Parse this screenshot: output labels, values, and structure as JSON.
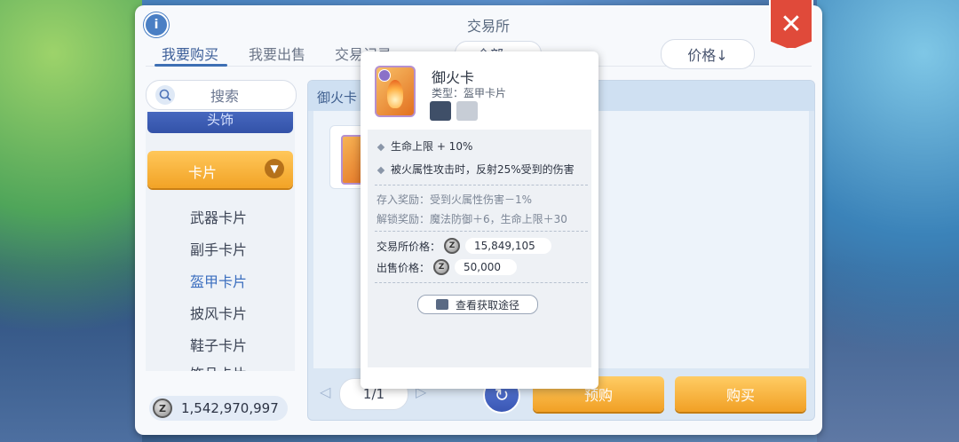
{
  "window": {
    "title": "交易所"
  },
  "tabs": [
    {
      "label": "我要购买",
      "active": true
    },
    {
      "label": "我要出售",
      "active": false
    },
    {
      "label": "交易记录",
      "active": false
    }
  ],
  "filter": {
    "dropdown_value": "全部"
  },
  "sort": {
    "label": "价格↓"
  },
  "search": {
    "label": "搜索"
  },
  "categories": {
    "prev_item": "头饰",
    "active": "卡片",
    "sub_items": [
      "武器卡片",
      "副手卡片",
      "盔甲卡片",
      "披风卡片",
      "鞋子卡片",
      "饰品卡片"
    ],
    "selected_sub": "盔甲卡片"
  },
  "wallet": {
    "balance": "1,542,970,997"
  },
  "content": {
    "header": "御火卡"
  },
  "pager": {
    "page": "1/1"
  },
  "actions": {
    "preorder": "预购",
    "buy": "购买"
  },
  "tooltip": {
    "name": "御火卡",
    "type": "类型：盔甲卡片",
    "attributes": [
      "生命上限 + 10%",
      "被火属性攻击时，反射25%受到的伤害"
    ],
    "deposit_bonus": "存入奖励：受到火属性伤害－1%",
    "unlock_bonus": "解锁奖励：魔法防御＋6，生命上限＋30",
    "exchange_price_label": "交易所价格：",
    "exchange_price": "15,849,105",
    "sell_price_label": "出售价格：",
    "sell_price": "50,000",
    "source_button": "查看获取途径"
  },
  "colors": {
    "accent_orange": "#f1a025",
    "accent_blue": "#3d6fb4",
    "close_red": "#e04a3a"
  }
}
